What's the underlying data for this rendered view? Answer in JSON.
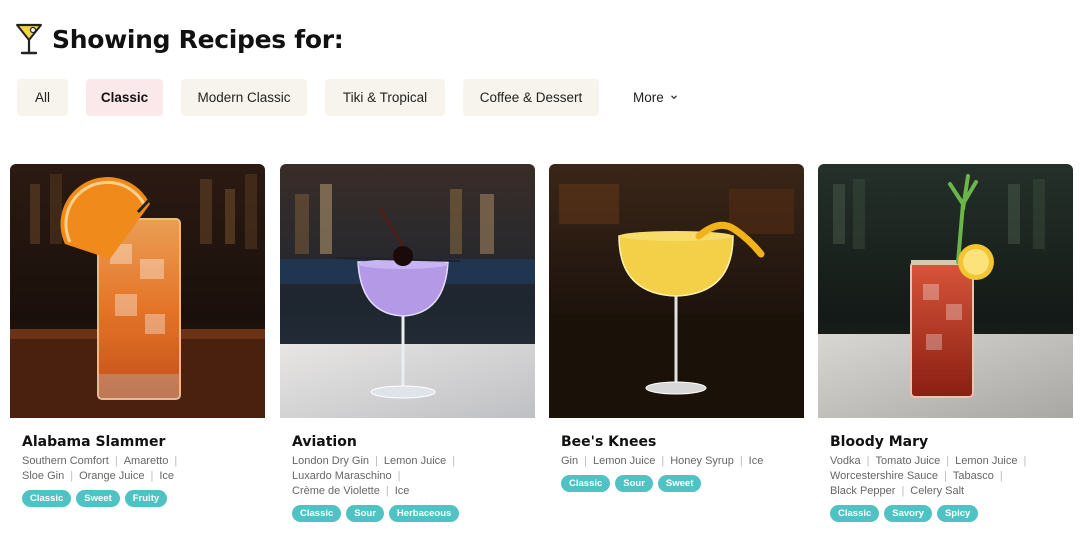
{
  "header": {
    "title": "Showing Recipes for:",
    "icon": "cocktail-glass-icon"
  },
  "filters": {
    "items": [
      {
        "label": "All",
        "active": false
      },
      {
        "label": "Classic",
        "active": true
      },
      {
        "label": "Modern Classic",
        "active": false
      },
      {
        "label": "Tiki & Tropical",
        "active": false
      },
      {
        "label": "Coffee & Dessert",
        "active": false
      }
    ],
    "more_label": "More"
  },
  "recipes": [
    {
      "name": "Alabama Slammer",
      "ingredient_lines": [
        [
          "Southern Comfort",
          "Amaretto",
          ""
        ],
        [
          "Sloe Gin",
          "Orange Juice",
          "Ice"
        ]
      ],
      "tags": [
        "Classic",
        "Sweet",
        "Fruity"
      ]
    },
    {
      "name": "Aviation",
      "ingredient_lines": [
        [
          "London Dry Gin",
          "Lemon Juice",
          ""
        ],
        [
          "Luxardo Maraschino",
          ""
        ],
        [
          "Crème de Violette",
          "Ice"
        ]
      ],
      "tags": [
        "Classic",
        "Sour",
        "Herbaceous"
      ]
    },
    {
      "name": "Bee's Knees",
      "ingredient_lines": [
        [
          "Gin",
          "Lemon Juice",
          "Honey Syrup",
          "Ice"
        ]
      ],
      "tags": [
        "Classic",
        "Sour",
        "Sweet"
      ]
    },
    {
      "name": "Bloody Mary",
      "ingredient_lines": [
        [
          "Vodka",
          "Tomato Juice",
          "Lemon Juice",
          ""
        ],
        [
          "Worcestershire Sauce",
          "Tabasco",
          ""
        ],
        [
          "Black Pepper",
          "Celery Salt"
        ]
      ],
      "tags": [
        "Classic",
        "Savory",
        "Spicy"
      ]
    }
  ],
  "colors": {
    "tag": "#4fc3c4",
    "chip": "#f6f4ec",
    "chip_active": "#fbe8ea"
  }
}
